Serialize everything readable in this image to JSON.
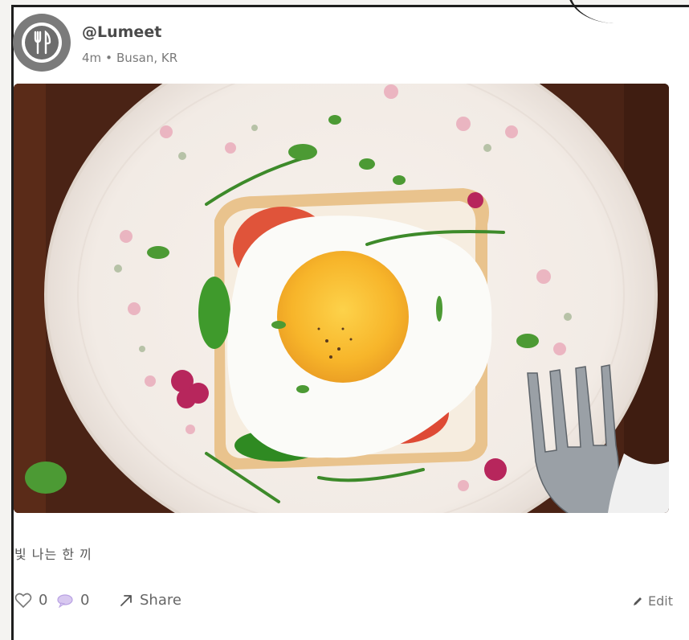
{
  "post": {
    "username": "@Lumeet",
    "time": "4m",
    "separator": "•",
    "location": "Busan, KR",
    "caption": "빛 나는 한 끼",
    "avatar_icon": "fork-knife-icon",
    "photo_description_icon": "food-photo"
  },
  "actions": {
    "likes": "0",
    "comments": "0",
    "share_label": "Share",
    "edit_label": "Edit"
  },
  "colors": {
    "avatar_bg": "#7b7b7b",
    "comment_icon": "#c9b5e8",
    "text_muted": "#7a7a7a"
  }
}
